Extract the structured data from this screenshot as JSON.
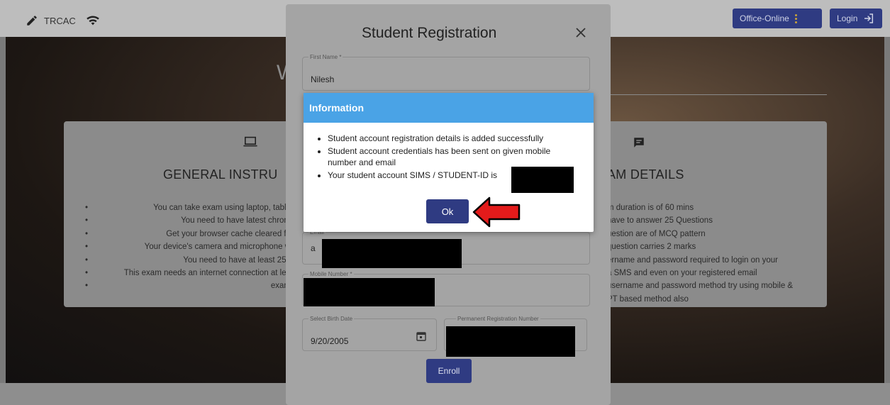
{
  "navbar": {
    "brand": "TRCAC",
    "office_label": "Office-Online",
    "login_label": "Login"
  },
  "hero": {
    "title_fragment": "W"
  },
  "left_card": {
    "icon": "laptop-icon",
    "heading": "GENERAL INSTRU",
    "items": [
      "You can take exam using laptop, table",
      "You need to have latest chrom",
      "Get your browser cache cleared fo",
      "Your device's camera and microphone w",
      "You need to have at least 256",
      "This exam needs an internet connection at lea",
      "exam"
    ]
  },
  "right_card": {
    "icon": "chat-icon",
    "heading": "AM DETAILS",
    "lines": [
      "m duration is of 60 mins",
      "have to answer 25 Questions",
      "uestion are of MCQ pattern",
      "question carries 2 marks",
      "ername and password required to login on your",
      "a SMS and even on your registered email",
      "username and password method try using mobile &",
      "PT based method also"
    ]
  },
  "registration": {
    "title": "Student Registration",
    "first_name_label": "First Name *",
    "first_name_value": "Nilesh",
    "email_label": "Email",
    "email_value": "a",
    "mobile_label": "Mobile Number *",
    "birth_label": "Select Birth Date",
    "birth_value": "9/20/2005",
    "perm_label": "Permanent Registration Number",
    "enroll_label": "Enroll"
  },
  "info_dialog": {
    "title": "Information",
    "messages": [
      "Student account registration details is added successfully",
      "Student account credentials has been sent on given mobile number and email",
      "Your student account SIMS / STUDENT-ID is"
    ],
    "ok_label": "Ok"
  },
  "colors": {
    "primary": "#2f3b82",
    "info_header": "#4aa3e6",
    "arrow": "#e31b1b"
  }
}
